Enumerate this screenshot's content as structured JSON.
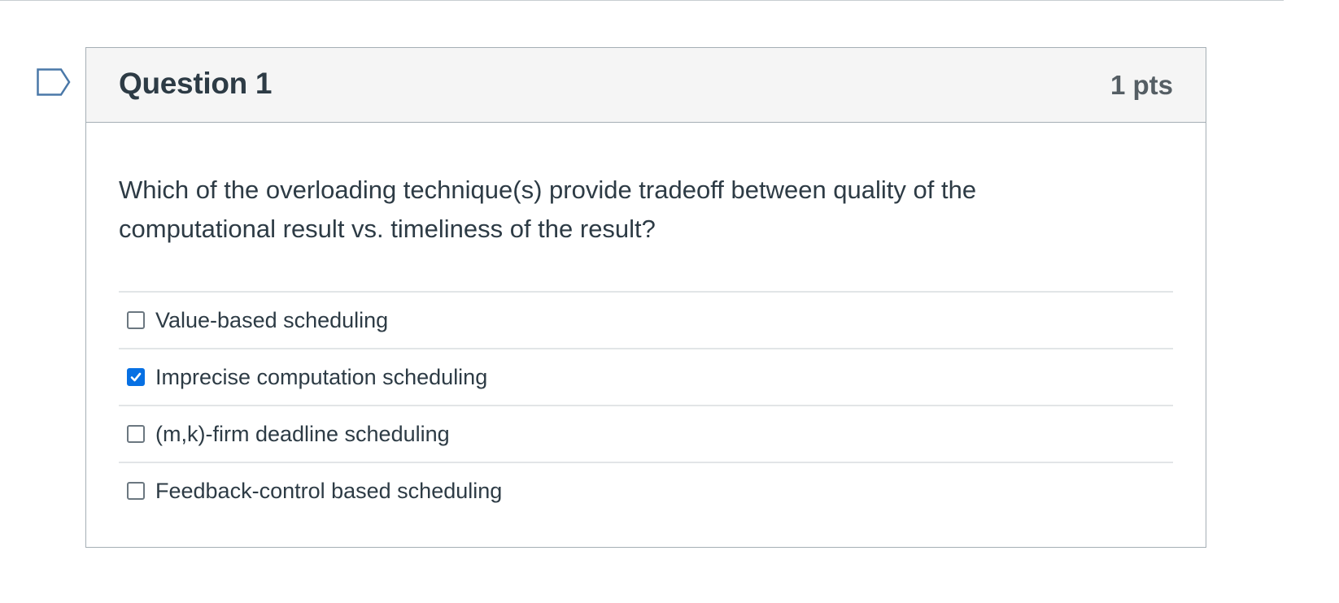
{
  "question": {
    "title": "Question 1",
    "points": "1 pts",
    "text": "Which of the overloading technique(s) provide tradeoff between quality of the computational result vs. timeliness of the result?",
    "answers": [
      {
        "label": "Value-based scheduling",
        "checked": false
      },
      {
        "label": "Imprecise computation scheduling",
        "checked": true
      },
      {
        "label": "(m,k)-firm deadline scheduling",
        "checked": false
      },
      {
        "label": "Feedback-control based scheduling",
        "checked": false
      }
    ]
  },
  "icons": {
    "flag": "flag-question-icon",
    "check": "checkmark-icon"
  },
  "colors": {
    "accent": "#0770e3",
    "text": "#2d3b45",
    "border": "#a5afb5",
    "header_bg": "#f5f5f5",
    "flag": "#4a78a8"
  }
}
